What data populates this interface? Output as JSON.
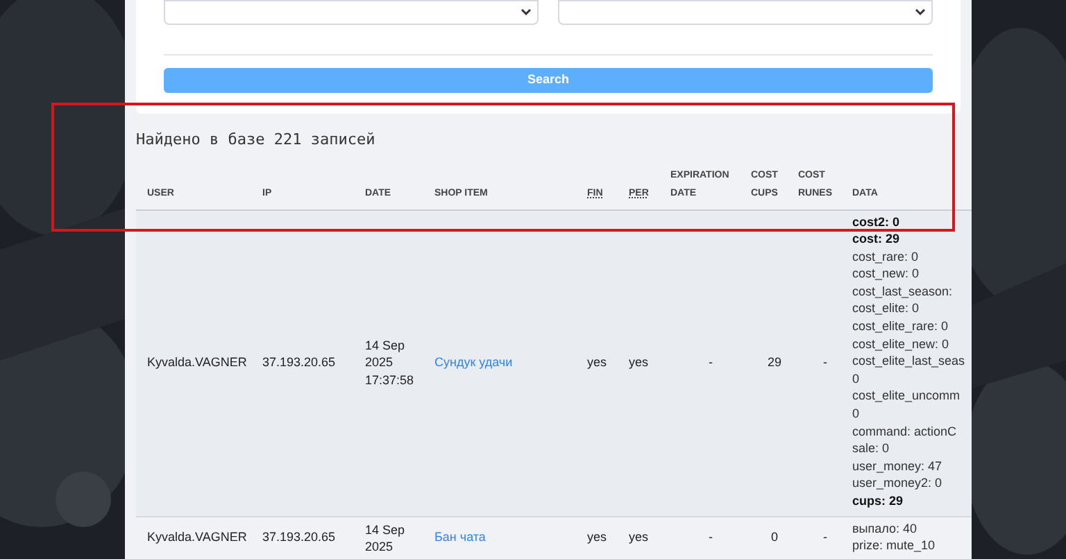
{
  "search_button": "Search",
  "result_summary": "Найдено в базе 221 записей",
  "table": {
    "columns": [
      {
        "label": "USER",
        "abbr": false
      },
      {
        "label": "IP",
        "abbr": false
      },
      {
        "label": "DATE",
        "abbr": false
      },
      {
        "label": "SHOP ITEM",
        "abbr": false
      },
      {
        "label": "FIN",
        "abbr": true
      },
      {
        "label": "PER",
        "abbr": true
      },
      {
        "label": "EXPIRATION DATE",
        "abbr": false
      },
      {
        "label": "COST CUPS",
        "abbr": false
      },
      {
        "label": "COST RUNES",
        "abbr": false
      },
      {
        "label": "DATA",
        "abbr": false
      }
    ],
    "rows": [
      {
        "user": "Kyvalda.VAGNER",
        "ip": "37.193.20.65",
        "date": [
          "14 Sep",
          "2025",
          "17:37:58"
        ],
        "shop_item": "Сундук удачи",
        "fin": "yes",
        "per": "yes",
        "expiration_date": "-",
        "cost_cups": "29",
        "cost_runes": "-",
        "data": [
          {
            "text": "cost2: 0",
            "bold": true
          },
          {
            "text": "cost: 29",
            "bold": true
          },
          {
            "text": "cost_rare: 0",
            "bold": false
          },
          {
            "text": "cost_new: 0",
            "bold": false
          },
          {
            "text": "cost_last_season:",
            "bold": false
          },
          {
            "text": "cost_elite: 0",
            "bold": false
          },
          {
            "text": "cost_elite_rare: 0",
            "bold": false
          },
          {
            "text": "cost_elite_new: 0",
            "bold": false
          },
          {
            "text": "cost_elite_last_seas",
            "bold": false
          },
          {
            "text": "0",
            "bold": false
          },
          {
            "text": "cost_elite_uncomm",
            "bold": false
          },
          {
            "text": "0",
            "bold": false
          },
          {
            "text": "command: actionC",
            "bold": false
          },
          {
            "text": "sale: 0",
            "bold": false
          },
          {
            "text": "user_money: 47",
            "bold": false
          },
          {
            "text": "user_money2: 0",
            "bold": false
          },
          {
            "text": "cups: 29",
            "bold": true
          }
        ]
      },
      {
        "user": "Kyvalda.VAGNER",
        "ip": "37.193.20.65",
        "date": [
          "14 Sep",
          "2025"
        ],
        "shop_item": "Бан чата",
        "fin": "yes",
        "per": "yes",
        "expiration_date": "-",
        "cost_cups": "0",
        "cost_runes": "-",
        "data": [
          {
            "text": "выпало: 40",
            "bold": false
          },
          {
            "text": "prize: mute_10",
            "bold": false
          }
        ]
      }
    ]
  }
}
